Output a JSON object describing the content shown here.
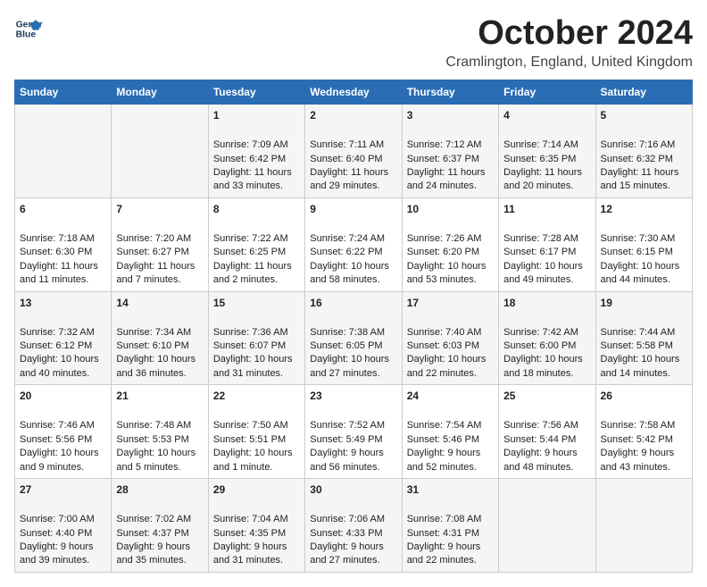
{
  "header": {
    "logo_line1": "General",
    "logo_line2": "Blue",
    "month_title": "October 2024",
    "location": "Cramlington, England, United Kingdom"
  },
  "days_of_week": [
    "Sunday",
    "Monday",
    "Tuesday",
    "Wednesday",
    "Thursday",
    "Friday",
    "Saturday"
  ],
  "weeks": [
    [
      {
        "day": "",
        "content": ""
      },
      {
        "day": "",
        "content": ""
      },
      {
        "day": "1",
        "content": "Sunrise: 7:09 AM\nSunset: 6:42 PM\nDaylight: 11 hours\nand 33 minutes."
      },
      {
        "day": "2",
        "content": "Sunrise: 7:11 AM\nSunset: 6:40 PM\nDaylight: 11 hours\nand 29 minutes."
      },
      {
        "day": "3",
        "content": "Sunrise: 7:12 AM\nSunset: 6:37 PM\nDaylight: 11 hours\nand 24 minutes."
      },
      {
        "day": "4",
        "content": "Sunrise: 7:14 AM\nSunset: 6:35 PM\nDaylight: 11 hours\nand 20 minutes."
      },
      {
        "day": "5",
        "content": "Sunrise: 7:16 AM\nSunset: 6:32 PM\nDaylight: 11 hours\nand 15 minutes."
      }
    ],
    [
      {
        "day": "6",
        "content": "Sunrise: 7:18 AM\nSunset: 6:30 PM\nDaylight: 11 hours\nand 11 minutes."
      },
      {
        "day": "7",
        "content": "Sunrise: 7:20 AM\nSunset: 6:27 PM\nDaylight: 11 hours\nand 7 minutes."
      },
      {
        "day": "8",
        "content": "Sunrise: 7:22 AM\nSunset: 6:25 PM\nDaylight: 11 hours\nand 2 minutes."
      },
      {
        "day": "9",
        "content": "Sunrise: 7:24 AM\nSunset: 6:22 PM\nDaylight: 10 hours\nand 58 minutes."
      },
      {
        "day": "10",
        "content": "Sunrise: 7:26 AM\nSunset: 6:20 PM\nDaylight: 10 hours\nand 53 minutes."
      },
      {
        "day": "11",
        "content": "Sunrise: 7:28 AM\nSunset: 6:17 PM\nDaylight: 10 hours\nand 49 minutes."
      },
      {
        "day": "12",
        "content": "Sunrise: 7:30 AM\nSunset: 6:15 PM\nDaylight: 10 hours\nand 44 minutes."
      }
    ],
    [
      {
        "day": "13",
        "content": "Sunrise: 7:32 AM\nSunset: 6:12 PM\nDaylight: 10 hours\nand 40 minutes."
      },
      {
        "day": "14",
        "content": "Sunrise: 7:34 AM\nSunset: 6:10 PM\nDaylight: 10 hours\nand 36 minutes."
      },
      {
        "day": "15",
        "content": "Sunrise: 7:36 AM\nSunset: 6:07 PM\nDaylight: 10 hours\nand 31 minutes."
      },
      {
        "day": "16",
        "content": "Sunrise: 7:38 AM\nSunset: 6:05 PM\nDaylight: 10 hours\nand 27 minutes."
      },
      {
        "day": "17",
        "content": "Sunrise: 7:40 AM\nSunset: 6:03 PM\nDaylight: 10 hours\nand 22 minutes."
      },
      {
        "day": "18",
        "content": "Sunrise: 7:42 AM\nSunset: 6:00 PM\nDaylight: 10 hours\nand 18 minutes."
      },
      {
        "day": "19",
        "content": "Sunrise: 7:44 AM\nSunset: 5:58 PM\nDaylight: 10 hours\nand 14 minutes."
      }
    ],
    [
      {
        "day": "20",
        "content": "Sunrise: 7:46 AM\nSunset: 5:56 PM\nDaylight: 10 hours\nand 9 minutes."
      },
      {
        "day": "21",
        "content": "Sunrise: 7:48 AM\nSunset: 5:53 PM\nDaylight: 10 hours\nand 5 minutes."
      },
      {
        "day": "22",
        "content": "Sunrise: 7:50 AM\nSunset: 5:51 PM\nDaylight: 10 hours\nand 1 minute."
      },
      {
        "day": "23",
        "content": "Sunrise: 7:52 AM\nSunset: 5:49 PM\nDaylight: 9 hours\nand 56 minutes."
      },
      {
        "day": "24",
        "content": "Sunrise: 7:54 AM\nSunset: 5:46 PM\nDaylight: 9 hours\nand 52 minutes."
      },
      {
        "day": "25",
        "content": "Sunrise: 7:56 AM\nSunset: 5:44 PM\nDaylight: 9 hours\nand 48 minutes."
      },
      {
        "day": "26",
        "content": "Sunrise: 7:58 AM\nSunset: 5:42 PM\nDaylight: 9 hours\nand 43 minutes."
      }
    ],
    [
      {
        "day": "27",
        "content": "Sunrise: 7:00 AM\nSunset: 4:40 PM\nDaylight: 9 hours\nand 39 minutes."
      },
      {
        "day": "28",
        "content": "Sunrise: 7:02 AM\nSunset: 4:37 PM\nDaylight: 9 hours\nand 35 minutes."
      },
      {
        "day": "29",
        "content": "Sunrise: 7:04 AM\nSunset: 4:35 PM\nDaylight: 9 hours\nand 31 minutes."
      },
      {
        "day": "30",
        "content": "Sunrise: 7:06 AM\nSunset: 4:33 PM\nDaylight: 9 hours\nand 27 minutes."
      },
      {
        "day": "31",
        "content": "Sunrise: 7:08 AM\nSunset: 4:31 PM\nDaylight: 9 hours\nand 22 minutes."
      },
      {
        "day": "",
        "content": ""
      },
      {
        "day": "",
        "content": ""
      }
    ]
  ]
}
